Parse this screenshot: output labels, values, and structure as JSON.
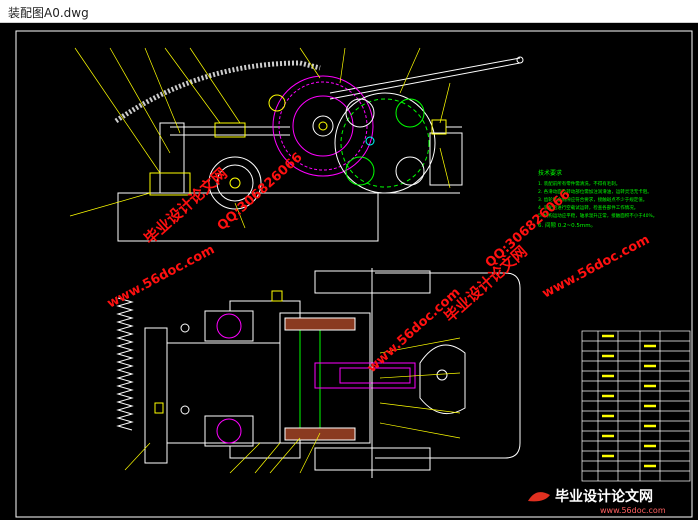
{
  "window": {
    "title": "装配图A0.dwg"
  },
  "tech_notes": {
    "heading": "技术要求",
    "lines": [
      "1. 装配前所有零件需清洗，不得有毛刺。",
      "2. 各滑动面及转动部位需加注润滑油，运转灵活无卡阻。",
      "3. 齿轮啮合侧隙应符合要求，接触斑点不少于规定值。",
      "4. 装配后进行空载试运转，检查各部件工作情况。",
      "5. 机构运动应平稳，轴承温升正常，接触面积不小于40%。",
      "6. 间隙 0.2~0.5mm。"
    ]
  },
  "watermarks": {
    "site_name": "毕业设计论文网",
    "site_url": "www.56doc.com",
    "qq": "QQ:306826066"
  },
  "logo": {
    "text": "毕业设计论文网",
    "url": "www.56doc.com"
  },
  "colors": {
    "background": "#000000",
    "line_white": "#ffffff",
    "line_magenta": "#ff00ff",
    "line_green": "#00ff00",
    "line_yellow": "#ffff00",
    "line_cyan": "#00ffff",
    "line_orange": "#ff9900",
    "watermark_red": "#ff1010"
  }
}
